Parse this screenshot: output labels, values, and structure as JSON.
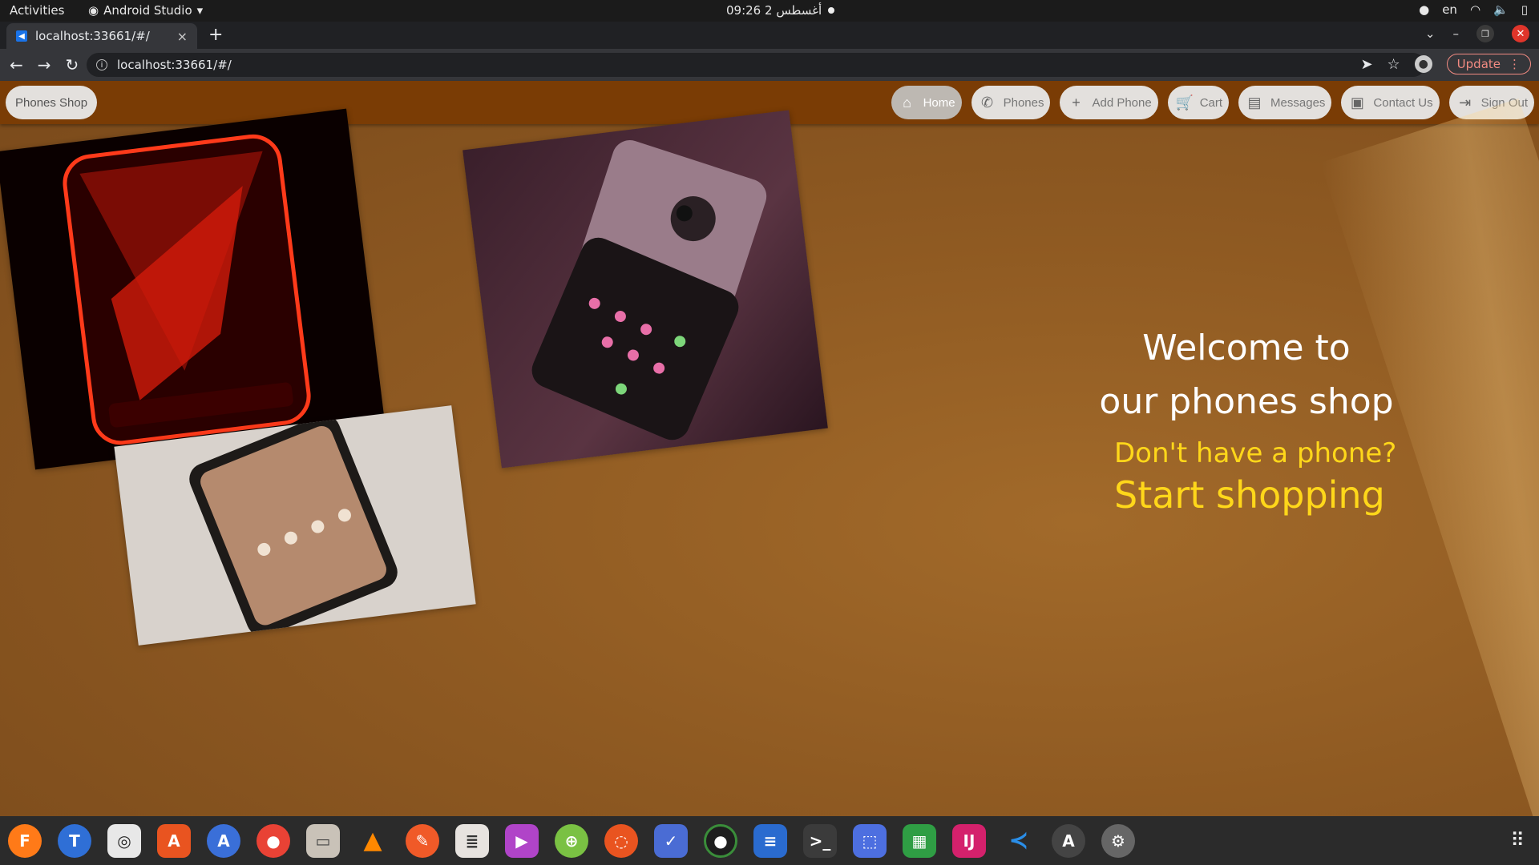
{
  "system": {
    "activities": "Activities",
    "app_name": "Android Studio",
    "clock": "09:26  2 أغسطس",
    "lang": "en"
  },
  "browser": {
    "tab_title": "localhost:33661/#/",
    "url": "localhost:33661/#/",
    "update_label": "Update"
  },
  "appbar": {
    "brand": "Phones Shop",
    "menu": [
      {
        "label": "Home",
        "icon": "home-icon"
      },
      {
        "label": "Phones",
        "icon": "phone-icon"
      },
      {
        "label": "Add Phone",
        "icon": "plus-icon"
      },
      {
        "label": "Cart",
        "icon": "cart-icon"
      },
      {
        "label": "Messages",
        "icon": "message-icon"
      },
      {
        "label": "Contact Us",
        "icon": "contact-icon"
      },
      {
        "label": "Sign Out",
        "icon": "sign-out-icon"
      }
    ]
  },
  "hero": {
    "welcome_line1": "Welcome to",
    "welcome_line2": "our phones shop",
    "question": "Don't have a phone?",
    "cta": "Start shopping"
  },
  "dock": [
    "firefox-icon",
    "thunderbird-icon",
    "rhythmbox-icon",
    "software-center-icon",
    "app-store-icon",
    "chrome-icon",
    "files-icon",
    "vlc-icon",
    "pencil-icon",
    "document-viewer-icon",
    "video-player-icon",
    "green-app-icon",
    "ubuntu-icon",
    "tasks-icon",
    "camera-icon",
    "writer-icon",
    "terminal-icon",
    "screenshot-icon",
    "calc-icon",
    "intellij-icon",
    "vscode-icon",
    "update-icon",
    "settings-icon"
  ],
  "colors": {
    "appbar": "#7a3c05",
    "background": "#8f5a22",
    "accent_yellow": "#ffd71a"
  }
}
